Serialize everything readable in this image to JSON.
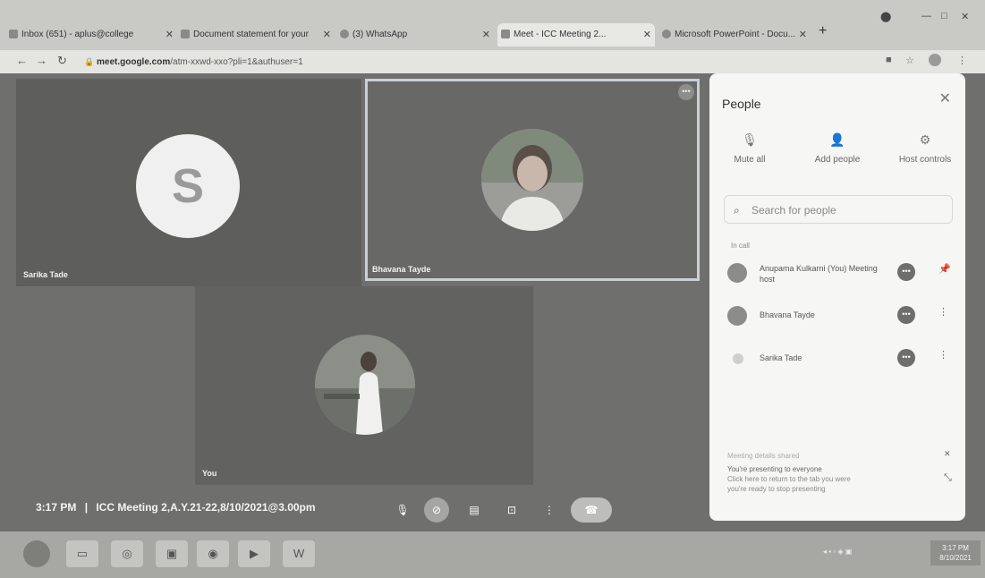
{
  "browser": {
    "tabs": [
      {
        "title": "Inbox (651) - aplus@college",
        "icon": "gmail-icon"
      },
      {
        "title": "Document statement for your",
        "icon": "gmail-icon"
      },
      {
        "title": "(3) WhatsApp",
        "icon": "whatsapp-icon"
      },
      {
        "title": "Meet - ICC Meeting 2...",
        "icon": "meet-icon",
        "active": true
      },
      {
        "title": "Microsoft PowerPoint - Docu...",
        "icon": "office-icon"
      }
    ],
    "new_tab": "+",
    "url_host": "meet.google.com",
    "url_path": "/atm-xxwd-xxo?pli=1&authuser=1"
  },
  "meet": {
    "tiles": [
      {
        "name": "Sarika Tade",
        "initial": "S"
      },
      {
        "name": "Bhavana Tayde"
      },
      {
        "name": "You"
      }
    ],
    "time": "3:17 PM",
    "separator": "|",
    "meeting_title": "ICC Meeting 2,A.Y.21-22,8/10/2021@3.00pm",
    "controls": [
      "mic-icon",
      "camera-off-icon",
      "captions-icon",
      "present-icon",
      "more-icon",
      "end-call-icon"
    ]
  },
  "people_panel": {
    "title": "People",
    "actions": [
      {
        "label": "Mute all",
        "icon": "mute-all-icon"
      },
      {
        "label": "Add people",
        "icon": "add-person-icon"
      },
      {
        "label": "Host controls",
        "icon": "host-controls-icon"
      }
    ],
    "search_placeholder": "Search for people",
    "section_label": "In call",
    "participants": [
      {
        "name": "Anupama Kulkarni (You) Meeting host"
      },
      {
        "name": "Bhavana Tayde"
      },
      {
        "name": "Sarika Tade"
      }
    ],
    "footer_heading": "Meeting details shared",
    "footer_line1": "You're presenting to everyone",
    "footer_line2": "Click here to return to the tab you were",
    "footer_line3": "you're ready to stop presenting"
  },
  "taskbar": {
    "clock_time": "3:17 PM",
    "clock_date": "8/10/2021"
  }
}
